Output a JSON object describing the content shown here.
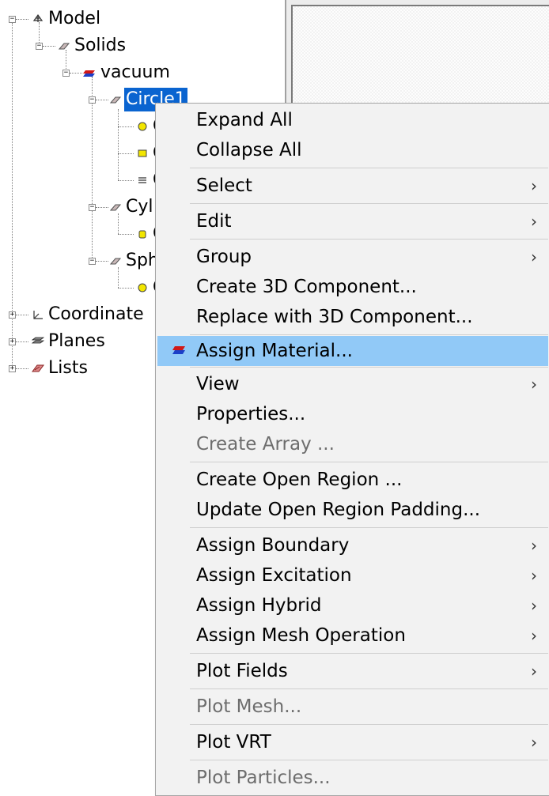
{
  "tree": {
    "model": "Model",
    "solids": "Solids",
    "vacuum": "vacuum",
    "circle1": "Circle1",
    "cylinder": "Cyl",
    "sphere": "Sph",
    "coordinate": "Coordinate",
    "planes": "Planes",
    "lists": "Lists",
    "expander_minus": "−",
    "expander_plus": "+"
  },
  "menu": {
    "expand_all": "Expand All",
    "collapse_all": "Collapse All",
    "select": "Select",
    "edit": "Edit",
    "group": "Group",
    "create_3d_component": "Create 3D Component...",
    "replace_3d_component": "Replace with 3D Component...",
    "assign_material": "Assign Material...",
    "view": "View",
    "properties": "Properties...",
    "create_array": "Create Array ...",
    "create_open_region": "Create Open Region ...",
    "update_open_region_padding": "Update Open Region Padding...",
    "assign_boundary": "Assign Boundary",
    "assign_excitation": "Assign Excitation",
    "assign_hybrid": "Assign Hybrid",
    "assign_mesh_operation": "Assign Mesh Operation",
    "plot_fields": "Plot Fields",
    "plot_mesh": "Plot Mesh...",
    "plot_vrt": "Plot VRT",
    "plot_particles": "Plot Particles...",
    "submenu_arrow": "›"
  },
  "colors": {
    "selection": "#0a64d0",
    "menu_highlight": "#91c9f7",
    "menu_bg": "#f2f2f2",
    "disabled_text": "#6d6d6d"
  }
}
